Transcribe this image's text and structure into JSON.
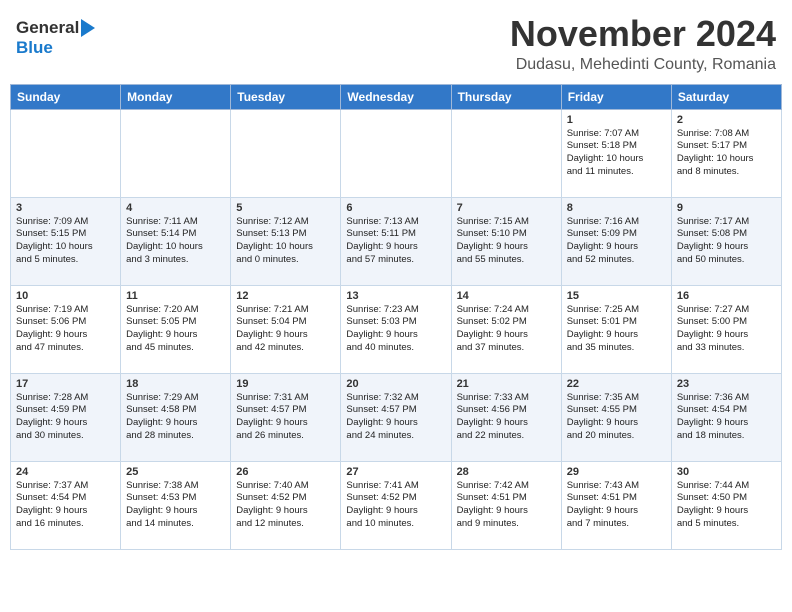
{
  "header": {
    "logo_general": "General",
    "logo_blue": "Blue",
    "month": "November 2024",
    "location": "Dudasu, Mehedinti County, Romania"
  },
  "weekdays": [
    "Sunday",
    "Monday",
    "Tuesday",
    "Wednesday",
    "Thursday",
    "Friday",
    "Saturday"
  ],
  "weeks": [
    [
      {
        "day": "",
        "info": ""
      },
      {
        "day": "",
        "info": ""
      },
      {
        "day": "",
        "info": ""
      },
      {
        "day": "",
        "info": ""
      },
      {
        "day": "",
        "info": ""
      },
      {
        "day": "1",
        "info": "Sunrise: 7:07 AM\nSunset: 5:18 PM\nDaylight: 10 hours\nand 11 minutes."
      },
      {
        "day": "2",
        "info": "Sunrise: 7:08 AM\nSunset: 5:17 PM\nDaylight: 10 hours\nand 8 minutes."
      }
    ],
    [
      {
        "day": "3",
        "info": "Sunrise: 7:09 AM\nSunset: 5:15 PM\nDaylight: 10 hours\nand 5 minutes."
      },
      {
        "day": "4",
        "info": "Sunrise: 7:11 AM\nSunset: 5:14 PM\nDaylight: 10 hours\nand 3 minutes."
      },
      {
        "day": "5",
        "info": "Sunrise: 7:12 AM\nSunset: 5:13 PM\nDaylight: 10 hours\nand 0 minutes."
      },
      {
        "day": "6",
        "info": "Sunrise: 7:13 AM\nSunset: 5:11 PM\nDaylight: 9 hours\nand 57 minutes."
      },
      {
        "day": "7",
        "info": "Sunrise: 7:15 AM\nSunset: 5:10 PM\nDaylight: 9 hours\nand 55 minutes."
      },
      {
        "day": "8",
        "info": "Sunrise: 7:16 AM\nSunset: 5:09 PM\nDaylight: 9 hours\nand 52 minutes."
      },
      {
        "day": "9",
        "info": "Sunrise: 7:17 AM\nSunset: 5:08 PM\nDaylight: 9 hours\nand 50 minutes."
      }
    ],
    [
      {
        "day": "10",
        "info": "Sunrise: 7:19 AM\nSunset: 5:06 PM\nDaylight: 9 hours\nand 47 minutes."
      },
      {
        "day": "11",
        "info": "Sunrise: 7:20 AM\nSunset: 5:05 PM\nDaylight: 9 hours\nand 45 minutes."
      },
      {
        "day": "12",
        "info": "Sunrise: 7:21 AM\nSunset: 5:04 PM\nDaylight: 9 hours\nand 42 minutes."
      },
      {
        "day": "13",
        "info": "Sunrise: 7:23 AM\nSunset: 5:03 PM\nDaylight: 9 hours\nand 40 minutes."
      },
      {
        "day": "14",
        "info": "Sunrise: 7:24 AM\nSunset: 5:02 PM\nDaylight: 9 hours\nand 37 minutes."
      },
      {
        "day": "15",
        "info": "Sunrise: 7:25 AM\nSunset: 5:01 PM\nDaylight: 9 hours\nand 35 minutes."
      },
      {
        "day": "16",
        "info": "Sunrise: 7:27 AM\nSunset: 5:00 PM\nDaylight: 9 hours\nand 33 minutes."
      }
    ],
    [
      {
        "day": "17",
        "info": "Sunrise: 7:28 AM\nSunset: 4:59 PM\nDaylight: 9 hours\nand 30 minutes."
      },
      {
        "day": "18",
        "info": "Sunrise: 7:29 AM\nSunset: 4:58 PM\nDaylight: 9 hours\nand 28 minutes."
      },
      {
        "day": "19",
        "info": "Sunrise: 7:31 AM\nSunset: 4:57 PM\nDaylight: 9 hours\nand 26 minutes."
      },
      {
        "day": "20",
        "info": "Sunrise: 7:32 AM\nSunset: 4:57 PM\nDaylight: 9 hours\nand 24 minutes."
      },
      {
        "day": "21",
        "info": "Sunrise: 7:33 AM\nSunset: 4:56 PM\nDaylight: 9 hours\nand 22 minutes."
      },
      {
        "day": "22",
        "info": "Sunrise: 7:35 AM\nSunset: 4:55 PM\nDaylight: 9 hours\nand 20 minutes."
      },
      {
        "day": "23",
        "info": "Sunrise: 7:36 AM\nSunset: 4:54 PM\nDaylight: 9 hours\nand 18 minutes."
      }
    ],
    [
      {
        "day": "24",
        "info": "Sunrise: 7:37 AM\nSunset: 4:54 PM\nDaylight: 9 hours\nand 16 minutes."
      },
      {
        "day": "25",
        "info": "Sunrise: 7:38 AM\nSunset: 4:53 PM\nDaylight: 9 hours\nand 14 minutes."
      },
      {
        "day": "26",
        "info": "Sunrise: 7:40 AM\nSunset: 4:52 PM\nDaylight: 9 hours\nand 12 minutes."
      },
      {
        "day": "27",
        "info": "Sunrise: 7:41 AM\nSunset: 4:52 PM\nDaylight: 9 hours\nand 10 minutes."
      },
      {
        "day": "28",
        "info": "Sunrise: 7:42 AM\nSunset: 4:51 PM\nDaylight: 9 hours\nand 9 minutes."
      },
      {
        "day": "29",
        "info": "Sunrise: 7:43 AM\nSunset: 4:51 PM\nDaylight: 9 hours\nand 7 minutes."
      },
      {
        "day": "30",
        "info": "Sunrise: 7:44 AM\nSunset: 4:50 PM\nDaylight: 9 hours\nand 5 minutes."
      }
    ]
  ]
}
